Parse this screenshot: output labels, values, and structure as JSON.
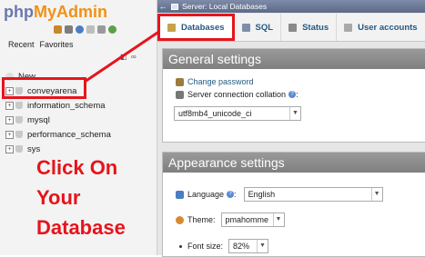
{
  "sidebar": {
    "logo": {
      "php": "php",
      "my": "My",
      "admin": "Admin"
    },
    "recent": "Recent",
    "favorites": "Favorites",
    "tree": [
      {
        "label": "New",
        "expander": ""
      },
      {
        "label": "conveyarena",
        "expander": "+"
      },
      {
        "label": "information_schema",
        "expander": "+"
      },
      {
        "label": "mysql",
        "expander": "+"
      },
      {
        "label": "performance_schema",
        "expander": "+"
      },
      {
        "label": "sys",
        "expander": "+"
      }
    ]
  },
  "annotation": {
    "line1": "Click On",
    "line2": "Your",
    "line3": "Database",
    "color": "#e6141c"
  },
  "serverbar": {
    "title": "Server: Local Databases"
  },
  "tabs": [
    {
      "label": "Databases",
      "active": true
    },
    {
      "label": "SQL"
    },
    {
      "label": "Status"
    },
    {
      "label": "User accounts"
    }
  ],
  "general": {
    "title": "General settings",
    "change_password": "Change password",
    "collation_label": "Server connection collation",
    "collation_value": "utf8mb4_unicode_ci"
  },
  "appearance": {
    "title": "Appearance settings",
    "language_label": "Language",
    "language_value": "English",
    "theme_label": "Theme:",
    "theme_value": "pmahomme",
    "font_label": "Font size:",
    "font_value": "82%"
  }
}
